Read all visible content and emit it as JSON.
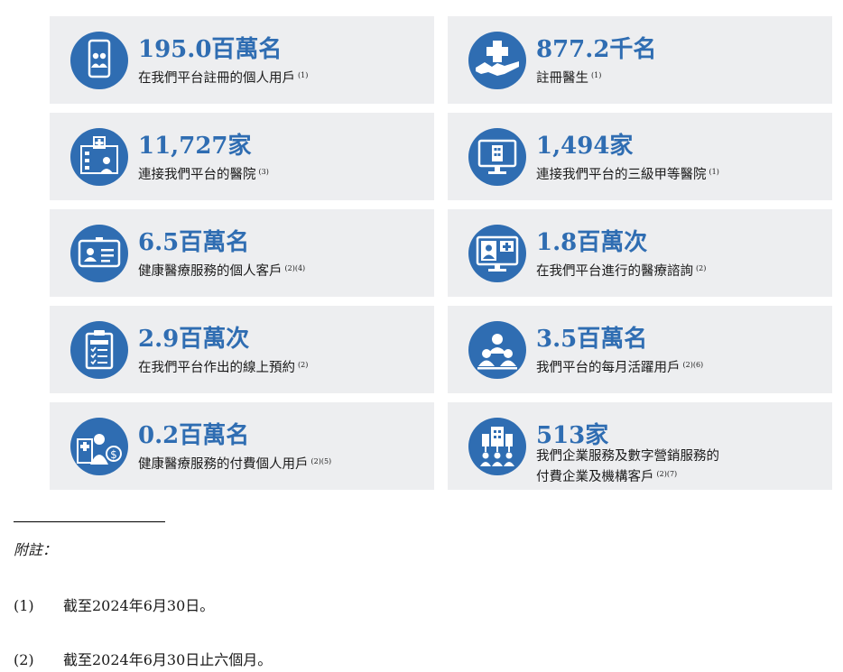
{
  "cards": [
    {
      "value": "195.0百萬名",
      "label": "在我們平台註冊的個人用戶",
      "fn": "(1)",
      "icon": "phone-users-icon"
    },
    {
      "value": "877.2千名",
      "label": "註冊醫生",
      "fn": "(1)",
      "icon": "handshake-medical-icon"
    },
    {
      "value": "11,727家",
      "label": "連接我們平台的醫院",
      "fn": "(3)",
      "icon": "hospital-building-icon"
    },
    {
      "value": "1,494家",
      "label": "連接我們平台的三級甲等醫院",
      "fn": "(1)",
      "icon": "monitor-hospital-icon"
    },
    {
      "value": "6.5百萬名",
      "label": "健康醫療服務的個人客戶",
      "fn": "(2)(4)",
      "icon": "id-card-icon"
    },
    {
      "value": "1.8百萬次",
      "label": "在我們平台進行的醫療諮詢",
      "fn": "(2)",
      "icon": "video-consult-icon"
    },
    {
      "value": "2.9百萬次",
      "label": "在我們平台作出的線上預約",
      "fn": "(2)",
      "icon": "clipboard-checklist-icon"
    },
    {
      "value": "3.5百萬名",
      "label": "我們平台的每月活躍用戶",
      "fn": "(2)(6)",
      "icon": "user-group-icon"
    },
    {
      "value": "0.2百萬名",
      "label": "健康醫療服務的付費個人用戶",
      "fn": "(2)(5)",
      "icon": "doctor-payment-icon"
    },
    {
      "value": "513家",
      "label": "我們企業服務及數字營銷服務的",
      "label2": "付費企業及機構客戶",
      "fn": "(2)(7)",
      "icon": "enterprise-network-icon"
    }
  ],
  "notes": {
    "title": "附註：",
    "items": [
      {
        "num": "(1)",
        "text": "截至2024年6月30日。"
      },
      {
        "num": "(2)",
        "text": "截至2024年6月30日止六個月。"
      }
    ]
  },
  "colors": {
    "accent": "#2f6db2",
    "card_bg": "#edeef0"
  }
}
